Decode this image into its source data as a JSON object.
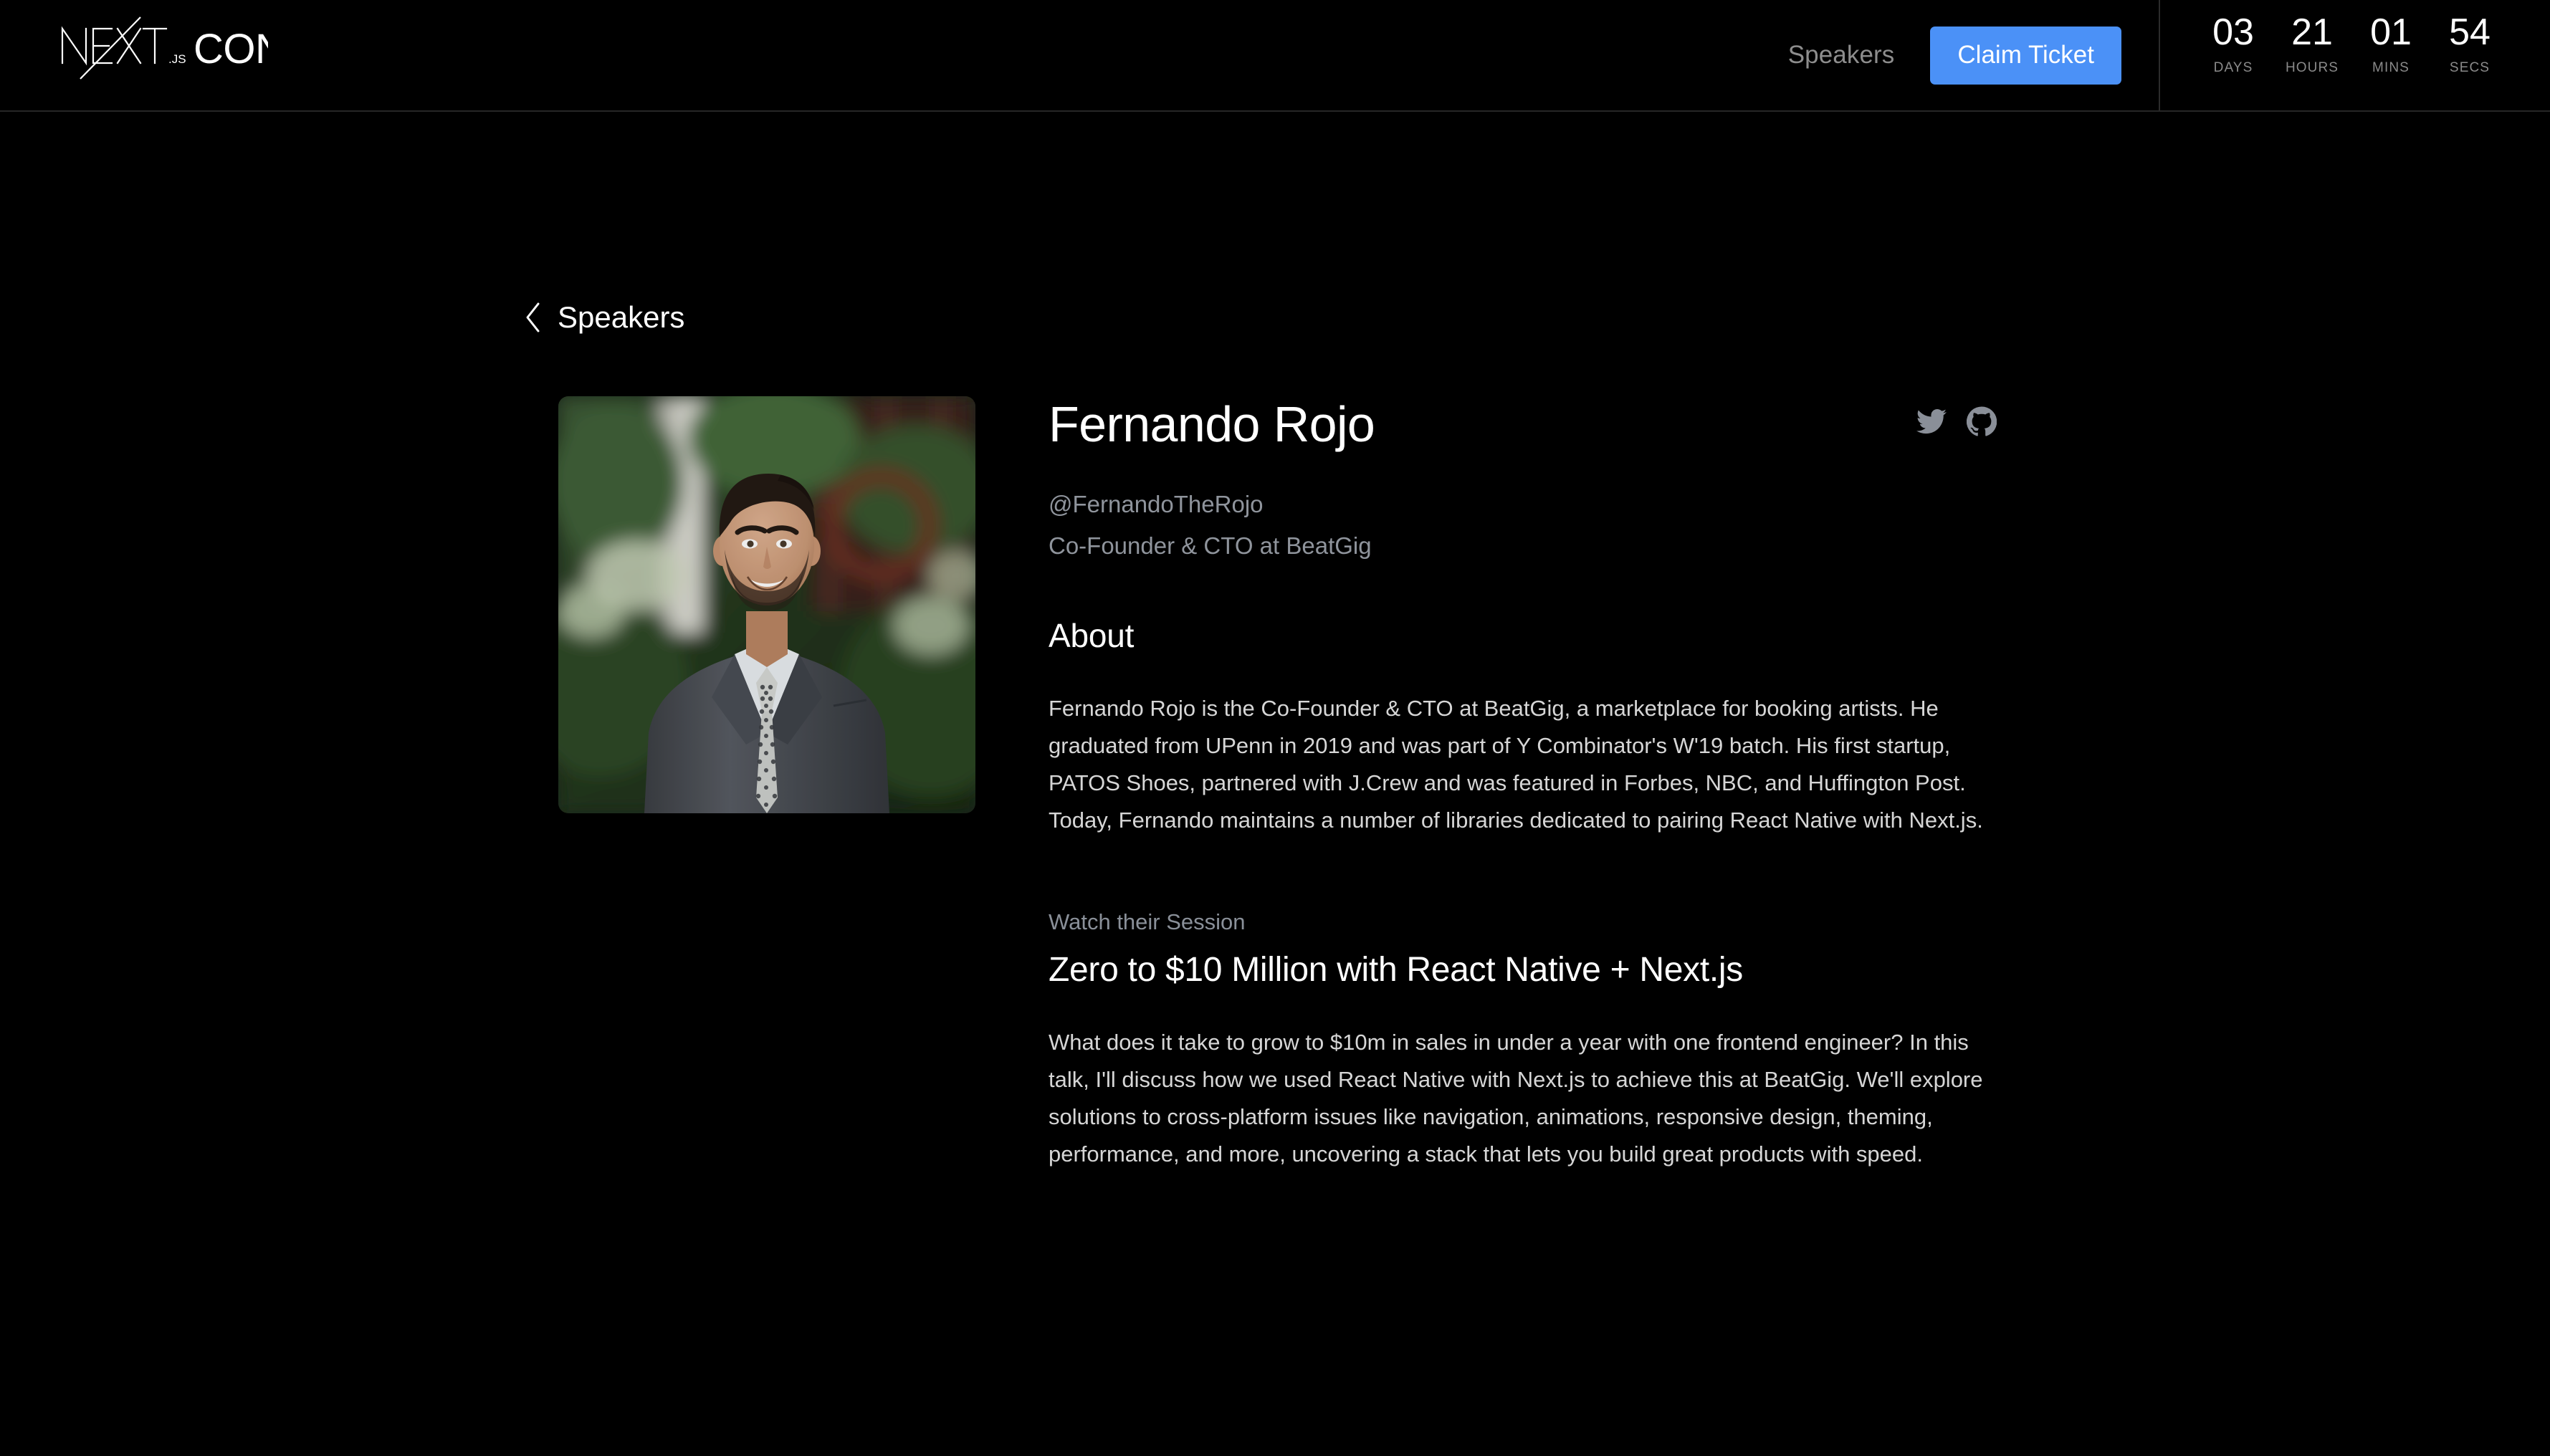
{
  "header": {
    "logo": {
      "word_mark": "NEXT",
      "suffix": ".JS",
      "conf": "CONF",
      "alt": "nextjs-conf-logo"
    },
    "nav": {
      "speakers_label": "Speakers"
    },
    "cta": {
      "claim_label": "Claim Ticket",
      "accent_color": "#4b91f7"
    },
    "countdown": [
      {
        "value": "03",
        "label": "DAYS"
      },
      {
        "value": "21",
        "label": "HOURS"
      },
      {
        "value": "01",
        "label": "MINS"
      },
      {
        "value": "54",
        "label": "SECS"
      }
    ]
  },
  "back_link": {
    "label": "Speakers",
    "icon": "chevron-left-icon"
  },
  "speaker": {
    "photo_alt": "Portrait of Fernando Rojo in a gray suit outdoors",
    "name": "Fernando Rojo",
    "handle": "@FernandoTheRojo",
    "role": "Co-Founder & CTO at BeatGig",
    "socials": [
      {
        "name": "twitter-icon",
        "label": "Twitter"
      },
      {
        "name": "github-icon",
        "label": "GitHub"
      }
    ],
    "about": {
      "heading": "About",
      "body": "Fernando Rojo is the Co-Founder & CTO at BeatGig, a marketplace for booking artists. He graduated from UPenn in 2019 and was part of Y Combinator's W'19 batch. His first startup, PATOS Shoes, partnered with J.Crew and was featured in Forbes, NBC, and Huffington Post. Today, Fernando maintains a number of libraries dedicated to pairing React Native with Next.js."
    },
    "session": {
      "eyebrow": "Watch their Session",
      "title": "Zero to $10 Million with React Native + Next.js",
      "description": "What does it take to grow to $10m in sales in under a year with one frontend engineer? In this talk, I'll discuss how we used React Native with Next.js to achieve this at BeatGig. We'll explore solutions to cross-platform issues like navigation, animations, responsive design, theming, performance, and more, uncovering a stack that lets you build great products with speed."
    }
  },
  "theme": {
    "background": "#000000",
    "text_primary": "#ffffff",
    "text_muted": "#8f949c",
    "accent": "#4b91f7"
  }
}
